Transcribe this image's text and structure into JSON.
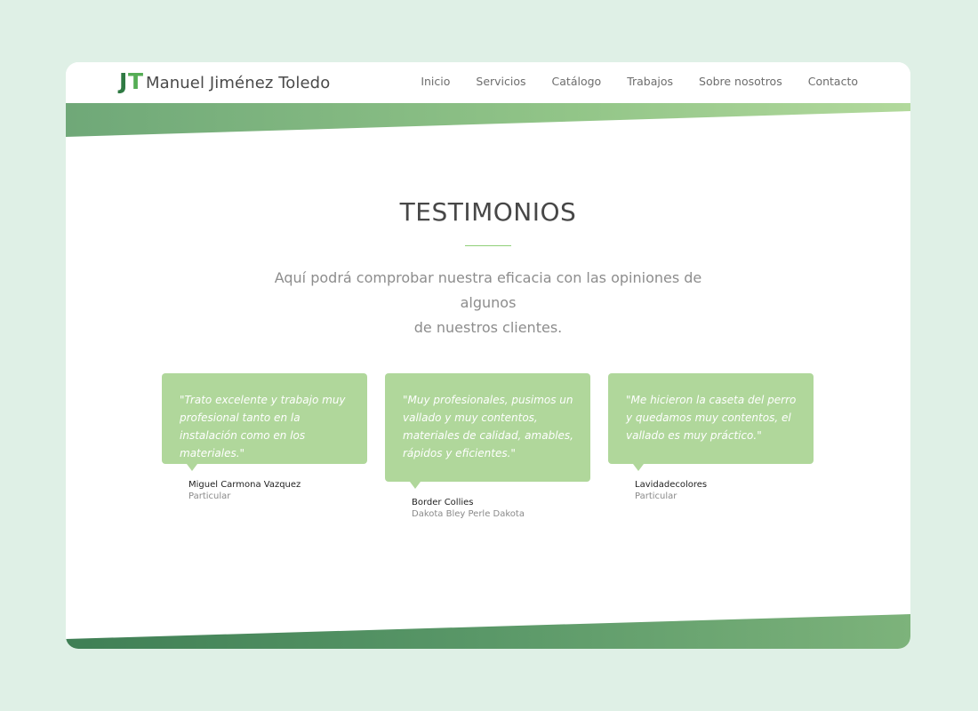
{
  "brand": {
    "logo_j": "J",
    "logo_t": "T",
    "name": "Manuel Jiménez Toledo"
  },
  "nav": [
    {
      "label": "Inicio"
    },
    {
      "label": "Servicios"
    },
    {
      "label": "Catálogo"
    },
    {
      "label": "Trabajos"
    },
    {
      "label": "Sobre nosotros"
    },
    {
      "label": "Contacto"
    }
  ],
  "section": {
    "title": "TESTIMONIOS",
    "intro_line1": "Aquí podrá comprobar nuestra eficacia con las opiniones de algunos",
    "intro_line2": "de nuestros clientes."
  },
  "testimonials": [
    {
      "quote": "\"Trato excelente y trabajo muy profesional tanto en la instalación como en los materiales.\"",
      "author": "Miguel Carmona Vazquez",
      "role": "Particular"
    },
    {
      "quote": "\"Muy profesionales, pusimos un vallado y muy contentos, materiales de calidad, amables, rápidos y eficientes.\"",
      "author": "Border Collies",
      "role": "Dakota Bley Perle Dakota"
    },
    {
      "quote": "\"Me hicieron la caseta del perro y quedamos muy contentos, el vallado es muy práctico.\"",
      "author": "Lavidadecolores",
      "role": "Particular"
    }
  ],
  "colors": {
    "page_background": "#dff0e6",
    "accent_green": "#b0d79b",
    "stripe_dark": "#4f9168",
    "stripe_light": "#a8d494",
    "logo_dark": "#2f7a43",
    "logo_light": "#55ad55"
  }
}
